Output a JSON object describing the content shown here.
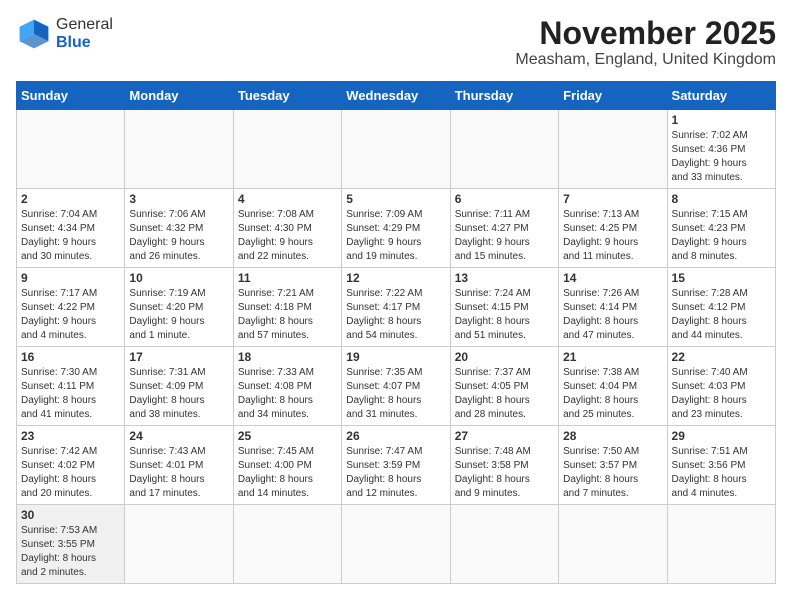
{
  "header": {
    "logo_general": "General",
    "logo_blue": "Blue",
    "month": "November 2025",
    "location": "Measham, England, United Kingdom"
  },
  "weekdays": [
    "Sunday",
    "Monday",
    "Tuesday",
    "Wednesday",
    "Thursday",
    "Friday",
    "Saturday"
  ],
  "weeks": [
    [
      {
        "day": "",
        "info": ""
      },
      {
        "day": "",
        "info": ""
      },
      {
        "day": "",
        "info": ""
      },
      {
        "day": "",
        "info": ""
      },
      {
        "day": "",
        "info": ""
      },
      {
        "day": "",
        "info": ""
      },
      {
        "day": "1",
        "info": "Sunrise: 7:02 AM\nSunset: 4:36 PM\nDaylight: 9 hours\nand 33 minutes."
      }
    ],
    [
      {
        "day": "2",
        "info": "Sunrise: 7:04 AM\nSunset: 4:34 PM\nDaylight: 9 hours\nand 30 minutes."
      },
      {
        "day": "3",
        "info": "Sunrise: 7:06 AM\nSunset: 4:32 PM\nDaylight: 9 hours\nand 26 minutes."
      },
      {
        "day": "4",
        "info": "Sunrise: 7:08 AM\nSunset: 4:30 PM\nDaylight: 9 hours\nand 22 minutes."
      },
      {
        "day": "5",
        "info": "Sunrise: 7:09 AM\nSunset: 4:29 PM\nDaylight: 9 hours\nand 19 minutes."
      },
      {
        "day": "6",
        "info": "Sunrise: 7:11 AM\nSunset: 4:27 PM\nDaylight: 9 hours\nand 15 minutes."
      },
      {
        "day": "7",
        "info": "Sunrise: 7:13 AM\nSunset: 4:25 PM\nDaylight: 9 hours\nand 11 minutes."
      },
      {
        "day": "8",
        "info": "Sunrise: 7:15 AM\nSunset: 4:23 PM\nDaylight: 9 hours\nand 8 minutes."
      }
    ],
    [
      {
        "day": "9",
        "info": "Sunrise: 7:17 AM\nSunset: 4:22 PM\nDaylight: 9 hours\nand 4 minutes."
      },
      {
        "day": "10",
        "info": "Sunrise: 7:19 AM\nSunset: 4:20 PM\nDaylight: 9 hours\nand 1 minute."
      },
      {
        "day": "11",
        "info": "Sunrise: 7:21 AM\nSunset: 4:18 PM\nDaylight: 8 hours\nand 57 minutes."
      },
      {
        "day": "12",
        "info": "Sunrise: 7:22 AM\nSunset: 4:17 PM\nDaylight: 8 hours\nand 54 minutes."
      },
      {
        "day": "13",
        "info": "Sunrise: 7:24 AM\nSunset: 4:15 PM\nDaylight: 8 hours\nand 51 minutes."
      },
      {
        "day": "14",
        "info": "Sunrise: 7:26 AM\nSunset: 4:14 PM\nDaylight: 8 hours\nand 47 minutes."
      },
      {
        "day": "15",
        "info": "Sunrise: 7:28 AM\nSunset: 4:12 PM\nDaylight: 8 hours\nand 44 minutes."
      }
    ],
    [
      {
        "day": "16",
        "info": "Sunrise: 7:30 AM\nSunset: 4:11 PM\nDaylight: 8 hours\nand 41 minutes."
      },
      {
        "day": "17",
        "info": "Sunrise: 7:31 AM\nSunset: 4:09 PM\nDaylight: 8 hours\nand 38 minutes."
      },
      {
        "day": "18",
        "info": "Sunrise: 7:33 AM\nSunset: 4:08 PM\nDaylight: 8 hours\nand 34 minutes."
      },
      {
        "day": "19",
        "info": "Sunrise: 7:35 AM\nSunset: 4:07 PM\nDaylight: 8 hours\nand 31 minutes."
      },
      {
        "day": "20",
        "info": "Sunrise: 7:37 AM\nSunset: 4:05 PM\nDaylight: 8 hours\nand 28 minutes."
      },
      {
        "day": "21",
        "info": "Sunrise: 7:38 AM\nSunset: 4:04 PM\nDaylight: 8 hours\nand 25 minutes."
      },
      {
        "day": "22",
        "info": "Sunrise: 7:40 AM\nSunset: 4:03 PM\nDaylight: 8 hours\nand 23 minutes."
      }
    ],
    [
      {
        "day": "23",
        "info": "Sunrise: 7:42 AM\nSunset: 4:02 PM\nDaylight: 8 hours\nand 20 minutes."
      },
      {
        "day": "24",
        "info": "Sunrise: 7:43 AM\nSunset: 4:01 PM\nDaylight: 8 hours\nand 17 minutes."
      },
      {
        "day": "25",
        "info": "Sunrise: 7:45 AM\nSunset: 4:00 PM\nDaylight: 8 hours\nand 14 minutes."
      },
      {
        "day": "26",
        "info": "Sunrise: 7:47 AM\nSunset: 3:59 PM\nDaylight: 8 hours\nand 12 minutes."
      },
      {
        "day": "27",
        "info": "Sunrise: 7:48 AM\nSunset: 3:58 PM\nDaylight: 8 hours\nand 9 minutes."
      },
      {
        "day": "28",
        "info": "Sunrise: 7:50 AM\nSunset: 3:57 PM\nDaylight: 8 hours\nand 7 minutes."
      },
      {
        "day": "29",
        "info": "Sunrise: 7:51 AM\nSunset: 3:56 PM\nDaylight: 8 hours\nand 4 minutes."
      }
    ],
    [
      {
        "day": "30",
        "info": "Sunrise: 7:53 AM\nSunset: 3:55 PM\nDaylight: 8 hours\nand 2 minutes."
      },
      {
        "day": "",
        "info": ""
      },
      {
        "day": "",
        "info": ""
      },
      {
        "day": "",
        "info": ""
      },
      {
        "day": "",
        "info": ""
      },
      {
        "day": "",
        "info": ""
      },
      {
        "day": "",
        "info": ""
      }
    ]
  ]
}
